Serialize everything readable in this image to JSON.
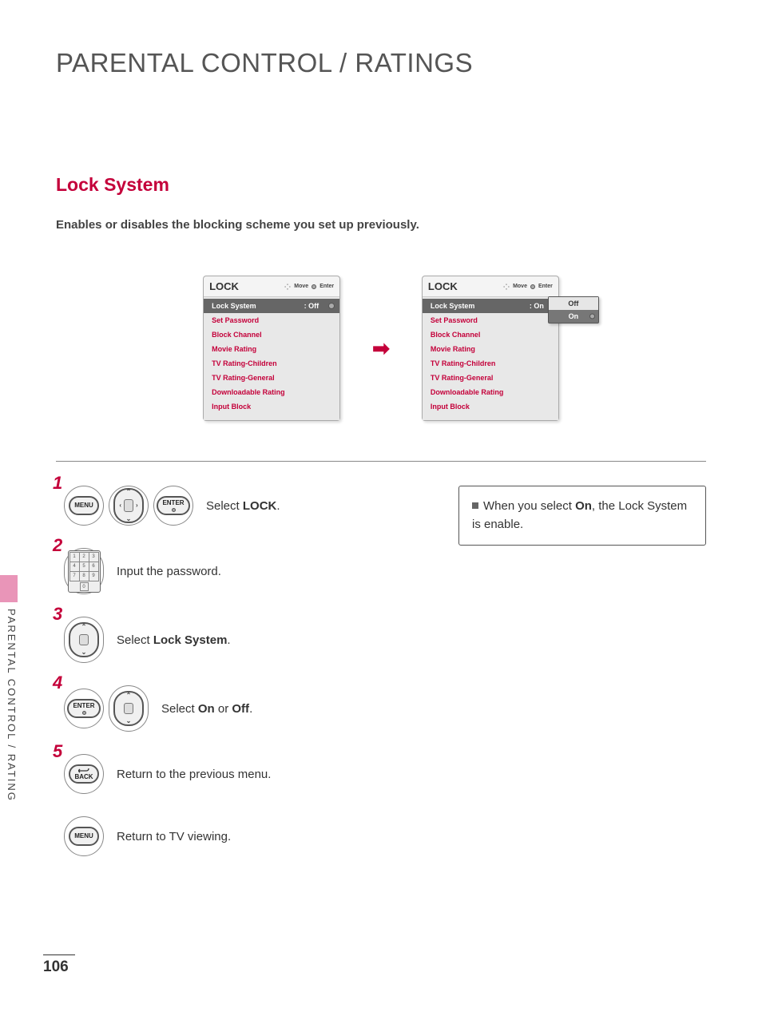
{
  "main_title": "PARENTAL CONTROL / RATINGS",
  "section_title": "Lock System",
  "section_desc": "Enables or disables the blocking scheme you set up previously.",
  "menu_a": {
    "title": "LOCK",
    "hint_move": "Move",
    "hint_enter": "Enter",
    "selected": {
      "label": "Lock System",
      "value": ": Off"
    },
    "items": [
      "Set Password",
      "Block Channel",
      "Movie Rating",
      "TV Rating-Children",
      "TV Rating-General",
      "Downloadable Rating",
      "Input Block"
    ]
  },
  "menu_b": {
    "title": "LOCK",
    "hint_move": "Move",
    "hint_enter": "Enter",
    "selected": {
      "label": "Lock System",
      "value": ": On"
    },
    "items": [
      "Set Password",
      "Block Channel",
      "Movie Rating",
      "TV Rating-Children",
      "TV Rating-General",
      "Downloadable Rating",
      "Input Block"
    ],
    "popup": {
      "opt_off": "Off",
      "opt_on": "On"
    }
  },
  "steps": {
    "s1_btn_menu": "MENU",
    "s1_btn_enter": "ENTER",
    "s1_text_pre": "Select ",
    "s1_text_bold": "LOCK",
    "s1_text_post": ".",
    "s2_text": "Input the password.",
    "s3_text_pre": "Select ",
    "s3_text_bold": "Lock System",
    "s3_text_post": ".",
    "s4_btn_enter": "ENTER",
    "s4_text_pre": "Select ",
    "s4_text_b1": "On",
    "s4_text_mid": " or ",
    "s4_text_b2": "Off",
    "s4_text_post": ".",
    "s5_btn_back": "BACK",
    "s5_text": "Return to the previous menu.",
    "s6_btn_menu": "MENU",
    "s6_text": "Return to TV viewing."
  },
  "note": {
    "text_pre": "When you select ",
    "text_bold": "On",
    "text_post": ", the Lock System is enable."
  },
  "side_tab": "PARENTAL CONTROL / RATING",
  "page_number": "106"
}
